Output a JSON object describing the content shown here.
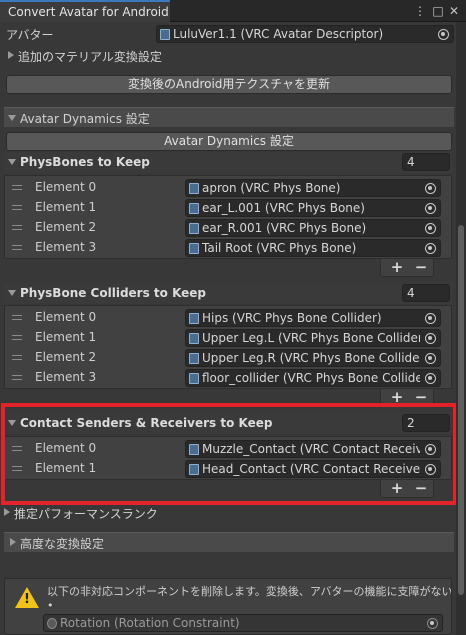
{
  "window": {
    "tab_title": "Convert Avatar for Android",
    "menu_icon": "kebab-menu-icon",
    "maximize_icon": "maximize-icon",
    "close_icon": "close-icon"
  },
  "avatar": {
    "label": "アバター",
    "value": "LuluVer1.1 (VRC Avatar Descriptor)"
  },
  "extra_materials": {
    "label": "追加のマテリアル変換設定"
  },
  "update_button": {
    "label": "変換後のAndroid用テクスチャを更新"
  },
  "avatar_dynamics": {
    "section_label": "Avatar Dynamics 設定",
    "button_label": "Avatar Dynamics 設定"
  },
  "physbones": {
    "title": "PhysBones to Keep",
    "count": "4",
    "elements": [
      {
        "label": "Element 0",
        "value": "apron (VRC Phys Bone)"
      },
      {
        "label": "Element 1",
        "value": "ear_L.001 (VRC Phys Bone)"
      },
      {
        "label": "Element 2",
        "value": "ear_R.001 (VRC Phys Bone)"
      },
      {
        "label": "Element 3",
        "value": "Tail Root (VRC Phys Bone)"
      }
    ]
  },
  "colliders": {
    "title": "PhysBone Colliders to Keep",
    "count": "4",
    "elements": [
      {
        "label": "Element 0",
        "value": "Hips (VRC Phys Bone Collider)"
      },
      {
        "label": "Element 1",
        "value": "Upper Leg.L (VRC Phys Bone Collider)"
      },
      {
        "label": "Element 2",
        "value": "Upper Leg.R (VRC Phys Bone Collider)"
      },
      {
        "label": "Element 3",
        "value": "floor_collider (VRC Phys Bone Collider)"
      }
    ]
  },
  "contacts": {
    "title": "Contact Senders & Receivers to Keep",
    "count": "2",
    "elements": [
      {
        "label": "Element 0",
        "value": "Muzzle_Contact (VRC Contact Receiver)"
      },
      {
        "label": "Element 1",
        "value": "Head_Contact (VRC Contact Receiver)"
      }
    ]
  },
  "list_controls": {
    "add": "+",
    "remove": "−"
  },
  "performance_rank": {
    "label": "推定パフォーマンスランク"
  },
  "advanced": {
    "label": "高度な変換設定"
  },
  "warning": {
    "text": "以下の非対応コンポーネントを削除します。変換後、アバターの機能に支障がないか確認してください",
    "bullet": "•",
    "component": "Rotation (Rotation Constraint)"
  },
  "colors": {
    "highlight": "#e2232a",
    "accent": "#3a79bb",
    "warning": "#f0c21a"
  }
}
